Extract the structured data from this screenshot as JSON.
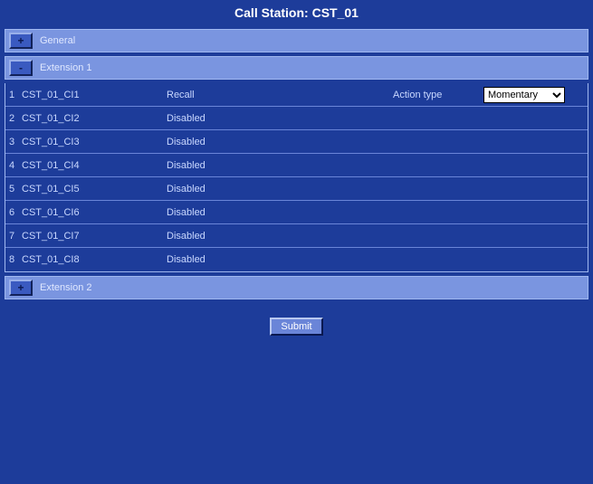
{
  "title": "Call Station: CST_01",
  "sections": {
    "general": {
      "toggle": "+",
      "label": "General"
    },
    "ext1": {
      "toggle": "-",
      "label": "Extension  1"
    },
    "ext2": {
      "toggle": "+",
      "label": "Extension  2"
    }
  },
  "action_label": "Action type",
  "action_selected": "Momentary",
  "action_options": [
    "Momentary"
  ],
  "rows": [
    {
      "idx": "1",
      "name": "CST_01_CI1",
      "state": "Recall",
      "has_action": true
    },
    {
      "idx": "2",
      "name": "CST_01_CI2",
      "state": "Disabled",
      "has_action": false
    },
    {
      "idx": "3",
      "name": "CST_01_CI3",
      "state": "Disabled",
      "has_action": false
    },
    {
      "idx": "4",
      "name": "CST_01_CI4",
      "state": "Disabled",
      "has_action": false
    },
    {
      "idx": "5",
      "name": "CST_01_CI5",
      "state": "Disabled",
      "has_action": false
    },
    {
      "idx": "6",
      "name": "CST_01_CI6",
      "state": "Disabled",
      "has_action": false
    },
    {
      "idx": "7",
      "name": "CST_01_CI7",
      "state": "Disabled",
      "has_action": false
    },
    {
      "idx": "8",
      "name": "CST_01_CI8",
      "state": "Disabled",
      "has_action": false
    }
  ],
  "submit_label": "Submit"
}
